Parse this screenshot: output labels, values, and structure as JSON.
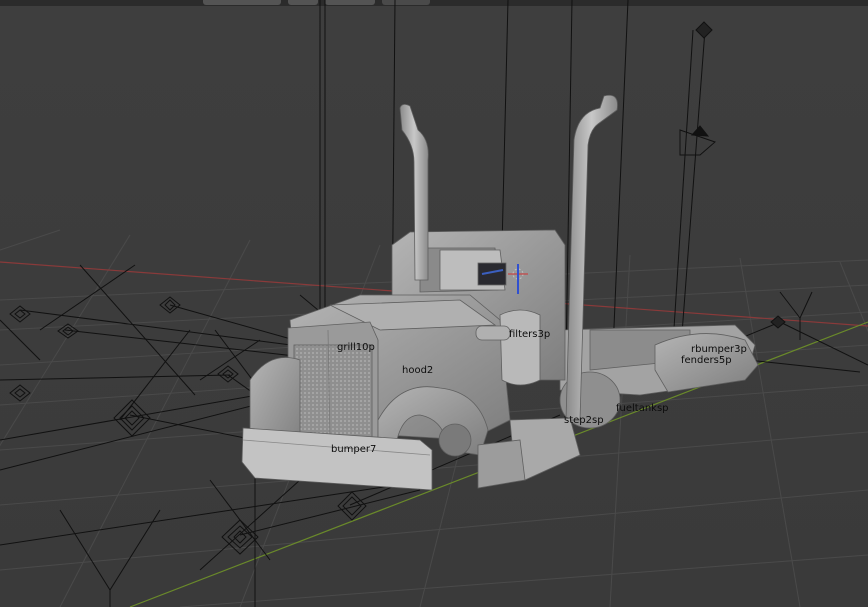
{
  "app": "Blender 3D Viewport",
  "labels": {
    "grill": "grill10p",
    "hood": "hood2",
    "filters": "filters3p",
    "rbumper": "rbumper3p",
    "fenders": "fenders5p",
    "fueltanks": "fueltanksp",
    "step": "step2sp",
    "bumper": "bumper7"
  },
  "colors": {
    "viewport_bg": "#3d3d3d",
    "grid": "#4a4a4a",
    "x_axis": "#8a3a3a",
    "y_axis": "#6a8a2a",
    "model": "#9a9a9a",
    "empty_lines": "#111111"
  }
}
